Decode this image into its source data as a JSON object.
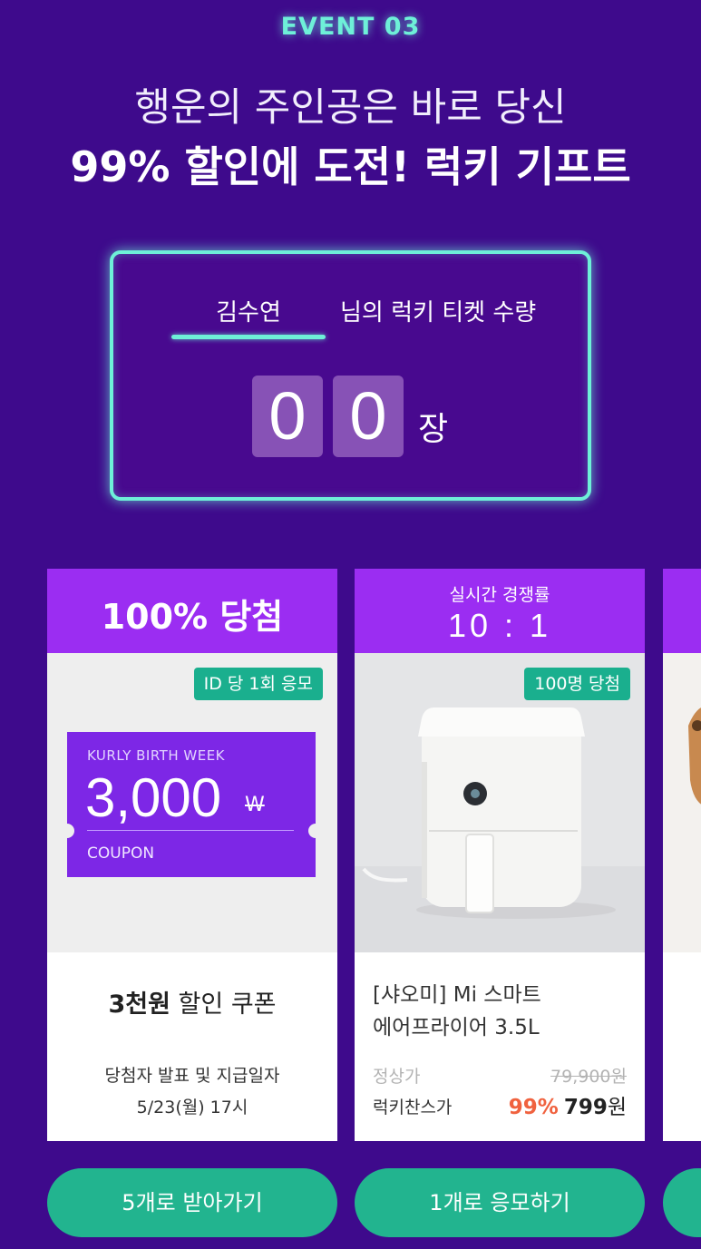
{
  "event": {
    "label": "EVENT 03",
    "headline_line1": "행운의 주인공은 바로 당신",
    "headline_line2": "99% 할인에 도전! 럭키 기프트"
  },
  "ticket": {
    "user_name": "김수연",
    "suffix": "님의 럭키 티켓 수량",
    "digit1": "0",
    "digit2": "0",
    "unit": "장"
  },
  "cards": [
    {
      "header_title": "100% 당첨",
      "badge": "ID 당 1회 응모",
      "coupon": {
        "top_text": "KURLY BIRTH WEEK",
        "amount": "3,000",
        "currency": "W",
        "bottom_text": "COUPON"
      },
      "title_bold": "3천원",
      "title_rest": " 할인 쿠폰",
      "info_line1": "당첨자 발표 및 지급일자",
      "info_line2": "5/23(월) 17시",
      "button_label": "5개로 받아가기"
    },
    {
      "header_small": "실시간 경쟁률",
      "header_ratio": "10 : 1",
      "badge": "100명 당첨",
      "image_icon": "air-fryer-image",
      "product_line1": "[샤오미] Mi 스마트",
      "product_line2": "에어프라이어 3.5L",
      "price_label": "정상가",
      "price_old": "79,900원",
      "lucky_label": "럭키찬스가",
      "lucky_discount": "99%",
      "lucky_price": "799",
      "lucky_currency": "원",
      "button_label": "1개로 응모하기"
    }
  ],
  "colors": {
    "background": "#3e0a8c",
    "accent_mint": "#6ef0d8",
    "card_header_purple": "#9b2df2",
    "button_green": "#22b48f",
    "discount_orange": "#f0623f"
  }
}
